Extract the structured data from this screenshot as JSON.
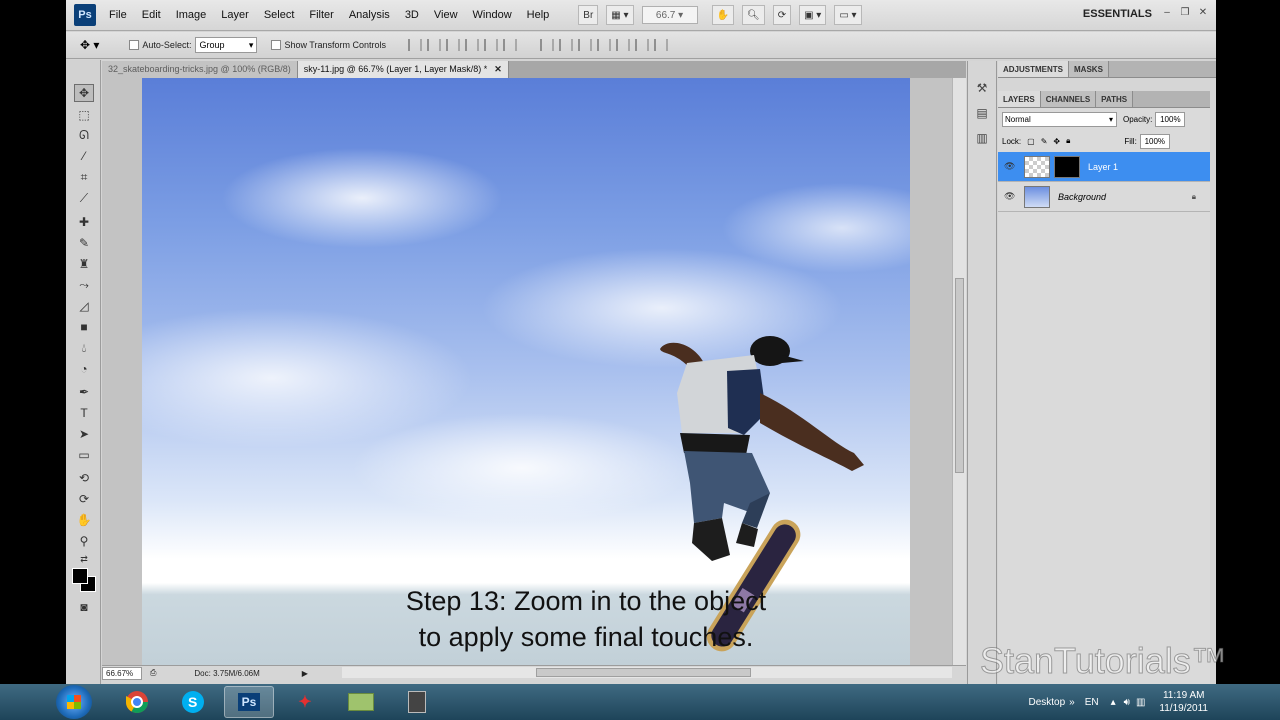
{
  "app": {
    "logo": "Ps"
  },
  "menu": [
    "File",
    "Edit",
    "Image",
    "Layer",
    "Select",
    "Filter",
    "Analysis",
    "3D",
    "View",
    "Window",
    "Help"
  ],
  "menubar": {
    "bridge_label": "Br",
    "zoom": "66.7",
    "workspace": "ESSENTIALS"
  },
  "options": {
    "auto_select_label": "Auto-Select:",
    "auto_select_value": "Group",
    "show_transform_label": "Show Transform Controls"
  },
  "tabs": [
    {
      "label": "32_skateboarding-tricks.jpg @ 100% (RGB/8)",
      "active": false
    },
    {
      "label": "sky-11.jpg @ 66.7% (Layer 1, Layer Mask/8) *",
      "active": true
    }
  ],
  "caption": {
    "line1": "Step 13: Zoom in to the object",
    "line2": "to apply some final touches."
  },
  "status": {
    "zoom": "66.67%",
    "doc_size": "Doc: 3.75M/6.06M"
  },
  "panels": {
    "top_tabs": [
      "ADJUSTMENTS",
      "MASKS"
    ],
    "layer_tabs": [
      "LAYERS",
      "CHANNELS",
      "PATHS"
    ],
    "blend_mode": "Normal",
    "opacity_label": "Opacity:",
    "opacity": "100%",
    "lock_label": "Lock:",
    "fill_label": "Fill:",
    "fill": "100%",
    "layers": [
      {
        "name": "Layer 1",
        "active": true
      },
      {
        "name": "Background",
        "active": false
      }
    ]
  },
  "taskbar": {
    "ps_label": "Ps",
    "desktop_label": "Desktop",
    "lang": "EN",
    "time": "11:19 AM",
    "date": "11/19/2011"
  },
  "watermark": "StanTutorials™",
  "icons": {
    "move": "move-icon",
    "marquee": "marquee-icon",
    "lasso": "lasso-icon",
    "wand": "magic-wand-icon",
    "crop": "crop-icon",
    "eyedropper": "eyedropper-icon",
    "brush": "brush-icon",
    "hand": "hand-icon",
    "zoom": "zoom-icon"
  }
}
